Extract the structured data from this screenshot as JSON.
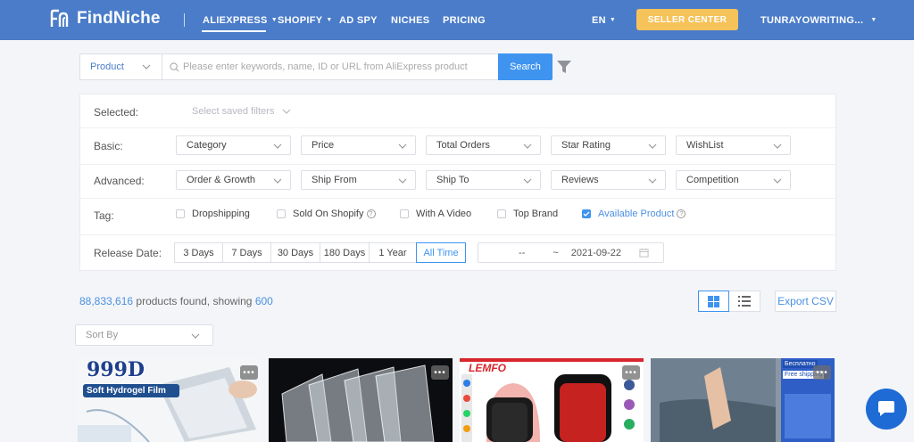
{
  "nav": {
    "brand": "FindNiche",
    "items": [
      {
        "label": "ALIEXPRESS",
        "caret": true
      },
      {
        "label": "SHOPIFY",
        "caret": true
      },
      {
        "label": "AD SPY",
        "caret": false
      },
      {
        "label": "NICHES",
        "caret": false
      },
      {
        "label": "PRICING",
        "caret": false
      }
    ],
    "language": "EN",
    "seller_center": "SELLER CENTER",
    "user": "TUNRAYOWRITING...",
    "accent": "#4a7cc9"
  },
  "search": {
    "type": "Product",
    "placeholder": "Please enter keywords, name, ID or URL from AliExpress product",
    "button": "Search"
  },
  "filters": {
    "selected_label": "Selected:",
    "saved_filters": "Select saved filters",
    "basic_label": "Basic:",
    "basic": [
      "Category",
      "Price",
      "Total Orders",
      "Star Rating",
      "WishList"
    ],
    "advanced_label": "Advanced:",
    "advanced": [
      "Order & Growth",
      "Ship From",
      "Ship To",
      "Reviews",
      "Competition"
    ],
    "tag_label": "Tag:",
    "tags": [
      {
        "label": "Dropshipping",
        "checked": false,
        "help": false
      },
      {
        "label": "Sold On Shopify",
        "checked": false,
        "help": true
      },
      {
        "label": "With A Video",
        "checked": false,
        "help": false
      },
      {
        "label": "Top Brand",
        "checked": false,
        "help": false
      },
      {
        "label": "Available Product",
        "checked": true,
        "help": true
      }
    ],
    "release_label": "Release Date:",
    "release_options": [
      "3 Days",
      "7 Days",
      "30 Days",
      "180 Days",
      "1 Year",
      "All Time"
    ],
    "release_active": "All Time",
    "date_from": "--",
    "date_sep": "~",
    "date_to": "2021-09-22"
  },
  "results": {
    "count": "88,833,616",
    "middle": " products found, showing ",
    "showing": "600",
    "export": "Export CSV",
    "sort_by": "Sort By"
  },
  "cards": [
    {
      "title_art": "999D",
      "subtitle_art": "Soft Hydrogel Film"
    },
    {
      "title_art": "",
      "subtitle_art": ""
    },
    {
      "title_art": "LEMFO",
      "subtitle_art": ""
    },
    {
      "title_art": "Бесплатно",
      "subtitle_art": "Free shipping"
    }
  ]
}
